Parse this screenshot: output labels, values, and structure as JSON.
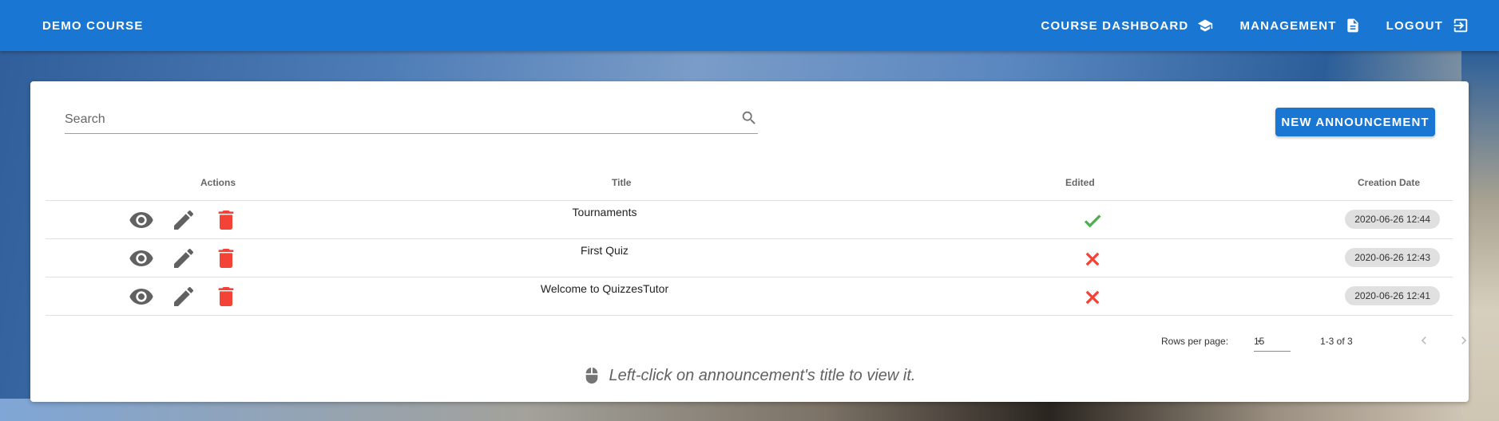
{
  "topbar": {
    "brand": "DEMO COURSE",
    "nav": [
      {
        "label": "COURSE DASHBOARD",
        "icon": "school-icon"
      },
      {
        "label": "MANAGEMENT",
        "icon": "document-icon"
      },
      {
        "label": "LOGOUT",
        "icon": "logout-icon"
      }
    ]
  },
  "toolbar": {
    "search_placeholder": "Search",
    "search_value": "",
    "new_button_label": "NEW ANNOUNCEMENT"
  },
  "table": {
    "headers": {
      "actions": "Actions",
      "title": "Title",
      "edited": "Edited",
      "creation_date": "Creation Date"
    },
    "rows": [
      {
        "title": "Tournaments",
        "edited": true,
        "creation_date": "2020-06-26 12:44"
      },
      {
        "title": "First Quiz",
        "edited": false,
        "creation_date": "2020-06-26 12:43"
      },
      {
        "title": "Welcome to QuizzesTutor",
        "edited": false,
        "creation_date": "2020-06-26 12:41"
      }
    ]
  },
  "footer": {
    "rows_per_page_label": "Rows per page:",
    "rows_per_page_value": "15",
    "range_text": "1-3 of 3"
  },
  "hint": "Left-click on announcement's title to view it.",
  "colors": {
    "primary": "#1976d2",
    "delete": "#f44336",
    "edited_true": "#4caf50",
    "edited_false": "#f44336",
    "icon_grey": "#616161"
  }
}
